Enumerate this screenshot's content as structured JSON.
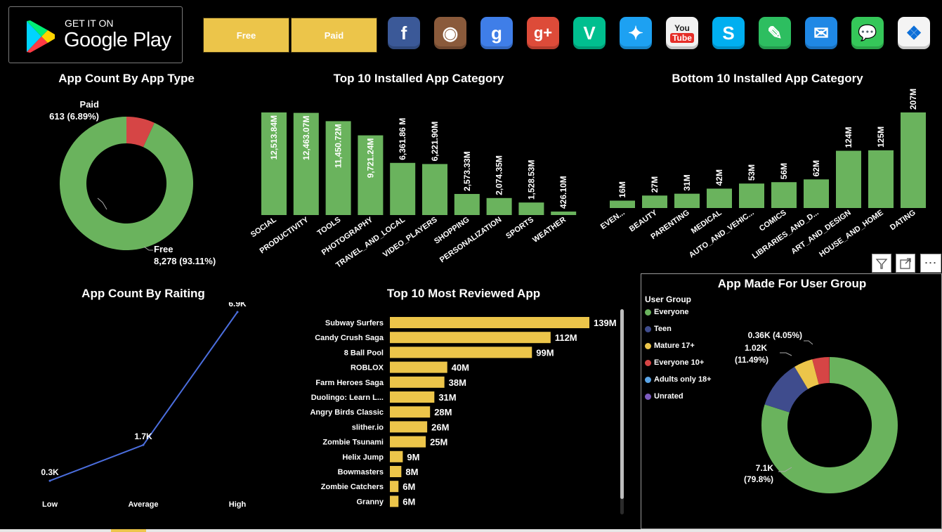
{
  "header": {
    "store_badge": {
      "small": "GET IT ON",
      "big": "Google Play"
    },
    "slicers": [
      "Free",
      "Paid"
    ],
    "social_icons": [
      {
        "name": "facebook-icon",
        "glyph": "f",
        "color": "#3b5998"
      },
      {
        "name": "instagram-icon",
        "glyph": "◉",
        "color": "#8a5a3b"
      },
      {
        "name": "google-icon",
        "glyph": "g",
        "color": "#3f7ee8"
      },
      {
        "name": "google-plus-icon",
        "glyph": "g+",
        "color": "#dd4b39"
      },
      {
        "name": "vine-icon",
        "glyph": "V",
        "color": "#00bf8f"
      },
      {
        "name": "twitter-icon",
        "glyph": "✦",
        "color": "#1da1f2"
      },
      {
        "name": "youtube-icon",
        "glyph": "You Tube",
        "color": "#f1f1f1"
      },
      {
        "name": "skype-icon",
        "glyph": "S",
        "color": "#00aff0"
      },
      {
        "name": "evernote-icon",
        "glyph": "✎",
        "color": "#2dbe60"
      },
      {
        "name": "mail-icon",
        "glyph": "✉",
        "color": "#1f88e5"
      },
      {
        "name": "message-icon",
        "glyph": "💬",
        "color": "#35c759"
      },
      {
        "name": "dropbox-icon",
        "glyph": "❖",
        "color": "#f4f4f4"
      }
    ]
  },
  "colors": {
    "green": "#6ab35d",
    "red": "#d64545",
    "yellow": "#ecc54a",
    "navy": "#3f4c8d",
    "blue": "#4b6ede",
    "lightblue": "#5aa5e8",
    "purple": "#7d5bbf"
  },
  "panels": {
    "app_type": {
      "title": "App Count By App Type",
      "paid_label": "Paid",
      "paid_value": "613 (6.89%)",
      "free_label": "Free",
      "free_value": "8,278 (93.11%)"
    },
    "top10": {
      "title": "Top 10 Installed App Category"
    },
    "bottom10": {
      "title": "Bottom 10 Installed App Category"
    },
    "rating": {
      "title": "App Count By Raiting"
    },
    "reviewed": {
      "title": "Top 10 Most Reviewed App"
    },
    "user_group": {
      "title": "App Made For User Group",
      "legend_title": "User Group",
      "label_teen_1": "1.02K",
      "label_teen_2": "(11.49%)",
      "label_e10": "0.36K (4.05%)",
      "label_everyone_1": "7.1K",
      "label_everyone_2": "(79.8%)"
    }
  },
  "chart_data": [
    {
      "type": "pie",
      "title": "App Count By App Type",
      "categories": [
        "Paid",
        "Free"
      ],
      "values": [
        613,
        8278
      ],
      "labels": [
        "613 (6.89%)",
        "8,278 (93.11%)"
      ]
    },
    {
      "type": "bar",
      "title": "Top 10 Installed App Category",
      "categories": [
        "SOCIAL",
        "PRODUCTIVITY",
        "TOOLS",
        "PHOTOGRAPHY",
        "TRAVEL_AND_LOCAL",
        "VIDEO_PLAYERS",
        "SHOPPING",
        "PERSONALIZATION",
        "SPORTS",
        "WEATHER"
      ],
      "values": [
        12513.84,
        12463.07,
        11450.72,
        9721.24,
        6361.86,
        6221.9,
        2573.33,
        2074.35,
        1528.53,
        426.1
      ],
      "labels": [
        "12,513.84M",
        "12,463.07M",
        "11,450.72M",
        "9,721.24M",
        "6,361.86 M",
        "6,221.90M",
        "2,573.33M",
        "2,074.35M",
        "1,528.53M",
        "426.10M"
      ]
    },
    {
      "type": "bar",
      "title": "Bottom 10 Installed App Category",
      "categories": [
        "EVEN...",
        "BEAUTY",
        "PARENTING",
        "MEDICAL",
        "AUTO_AND_VEHIC...",
        "COMICS",
        "LIBRARIES_AND_D...",
        "ART_AND_DESIGN",
        "HOUSE_AND_HOME",
        "DATING"
      ],
      "values": [
        16,
        27,
        31,
        42,
        53,
        56,
        62,
        124,
        125,
        207
      ],
      "labels": [
        "16M",
        "27M",
        "31M",
        "42M",
        "53M",
        "56M",
        "62M",
        "124M",
        "125M",
        "207M"
      ]
    },
    {
      "type": "line",
      "title": "App Count By Raiting",
      "categories": [
        "Low",
        "Average",
        "High"
      ],
      "values": [
        0.3,
        1.7,
        6.9
      ],
      "labels": [
        "0.3K",
        "1.7K",
        "6.9K"
      ]
    },
    {
      "type": "bar",
      "orientation": "horizontal",
      "title": "Top 10 Most Reviewed App",
      "categories": [
        "Subway Surfers",
        "Candy Crush Saga",
        "8 Ball Pool",
        "ROBLOX",
        "Farm Heroes Saga",
        "Duolingo: Learn L...",
        "Angry Birds Classic",
        "slither.io",
        "Zombie Tsunami",
        "Helix Jump",
        "Bowmasters",
        "Zombie Catchers",
        "Granny"
      ],
      "values": [
        139,
        112,
        99,
        40,
        38,
        31,
        28,
        26,
        25,
        9,
        8,
        6,
        6
      ],
      "labels": [
        "139M",
        "112M",
        "99M",
        "40M",
        "38M",
        "31M",
        "28M",
        "26M",
        "25M",
        "9M",
        "8M",
        "6M",
        "6M"
      ]
    },
    {
      "type": "pie",
      "title": "App Made For User Group",
      "categories": [
        "Everyone",
        "Teen",
        "Mature 17+",
        "Everyone 10+",
        "Adults only 18+",
        "Unrated"
      ],
      "values": [
        7.1,
        1.02,
        0.4,
        0.36,
        0.003,
        0.002
      ],
      "colors": [
        "#6ab35d",
        "#3f4c8d",
        "#ecc54a",
        "#d64545",
        "#5aa5e8",
        "#7d5bbf"
      ]
    }
  ]
}
